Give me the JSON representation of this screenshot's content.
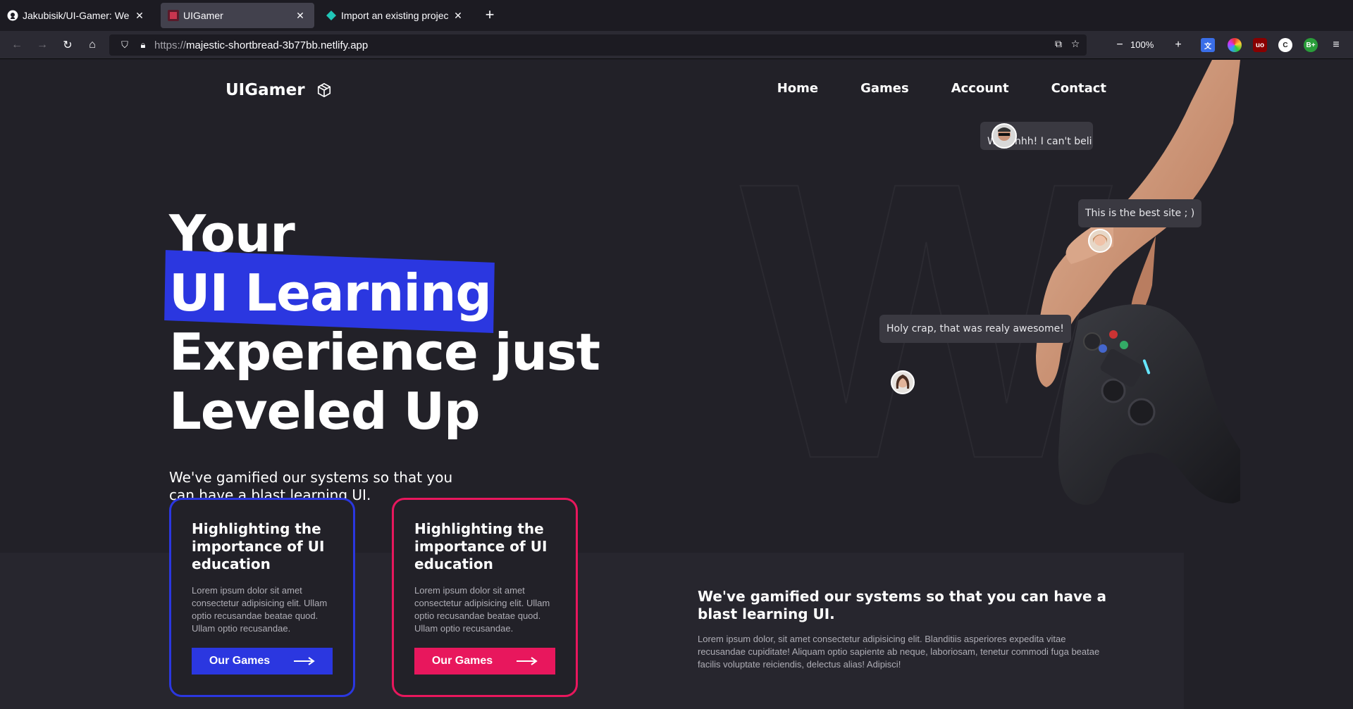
{
  "browser": {
    "tabs": [
      {
        "title": "Jakubisik/UI-Gamer: Websi",
        "favicon": "github-icon",
        "active": false
      },
      {
        "title": "UIGamer",
        "favicon": "uigamer-icon",
        "active": true
      },
      {
        "title": "Import an existing project",
        "favicon": "netlify-icon",
        "active": false
      }
    ],
    "url_prefix": "https://",
    "url_host": "majestic-shortbread-3b77bb.netlify.app",
    "zoom": "100%"
  },
  "site": {
    "logo": "UIGamer",
    "nav": [
      "Home",
      "Games",
      "Account",
      "Contact"
    ],
    "hero": {
      "line1_plain": "Your",
      "line1_highlight": "UI Learning",
      "line2": "Experience just",
      "line3": "Leveled Up",
      "subtitle": "We've gamified our systems so that you can have a blast learning UI."
    },
    "cards": [
      {
        "title": "Highlighting the importance of UI education",
        "body": "Lorem ipsum dolor sit amet consectetur adipisicing elit. Ullam optio recusandae beatae quod. Ullam optio recusandae.",
        "button": "Our Games",
        "accent": "#2b37e0"
      },
      {
        "title": "Highlighting the importance of UI education",
        "body": "Lorem ipsum dolor sit amet consectetur adipisicing elit. Ullam optio recusandae beatae quod. Ullam optio recusandae.",
        "button": "Our Games",
        "accent": "#e8175d"
      }
    ],
    "info": {
      "title": "We've gamified our systems so that you can have a blast learning UI.",
      "body": "Lorem ipsum dolor, sit amet consectetur adipisicing elit. Blanditiis asperiores expedita vitae recusandae cupiditate! Aliquam optio sapiente ab neque, laboriosam, tenetur commodi fuga beatae facilis voluptate reiciendis, delectus alias! Adipisci!"
    },
    "bubbles": [
      {
        "text": "Woahhhh! I can't beli"
      },
      {
        "text": "This is the best site ; )"
      },
      {
        "text": "Holy crap, that was realy awesome!"
      }
    ]
  }
}
